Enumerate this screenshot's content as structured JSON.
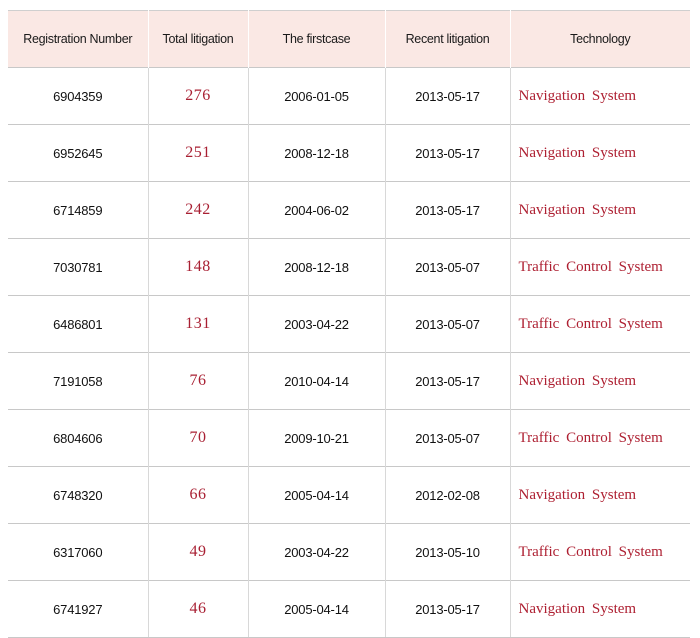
{
  "table": {
    "columns": [
      {
        "key": "registration_number",
        "label": "Registration Number"
      },
      {
        "key": "total_litigation",
        "label": "Total litigation"
      },
      {
        "key": "first_case",
        "label": "The firstcase"
      },
      {
        "key": "recent_litigation",
        "label": "Recent litigation"
      },
      {
        "key": "technology",
        "label": "Technology"
      }
    ],
    "rows": [
      {
        "registration_number": "6904359",
        "total_litigation": "276",
        "first_case": "2006-01-05",
        "recent_litigation": "2013-05-17",
        "technology": "Navigation System"
      },
      {
        "registration_number": "6952645",
        "total_litigation": "251",
        "first_case": "2008-12-18",
        "recent_litigation": "2013-05-17",
        "technology": "Navigation System"
      },
      {
        "registration_number": "6714859",
        "total_litigation": "242",
        "first_case": "2004-06-02",
        "recent_litigation": "2013-05-17",
        "technology": "Navigation System"
      },
      {
        "registration_number": "7030781",
        "total_litigation": "148",
        "first_case": "2008-12-18",
        "recent_litigation": "2013-05-07",
        "technology": "Traffic Control System"
      },
      {
        "registration_number": "6486801",
        "total_litigation": "131",
        "first_case": "2003-04-22",
        "recent_litigation": "2013-05-07",
        "technology": "Traffic Control System"
      },
      {
        "registration_number": "7191058",
        "total_litigation": "76",
        "first_case": "2010-04-14",
        "recent_litigation": "2013-05-17",
        "technology": "Navigation System"
      },
      {
        "registration_number": "6804606",
        "total_litigation": "70",
        "first_case": "2009-10-21",
        "recent_litigation": "2013-05-07",
        "technology": "Traffic Control System"
      },
      {
        "registration_number": "6748320",
        "total_litigation": "66",
        "first_case": "2005-04-14",
        "recent_litigation": "2012-02-08",
        "technology": "Navigation System"
      },
      {
        "registration_number": "6317060",
        "total_litigation": "49",
        "first_case": "2003-04-22",
        "recent_litigation": "2013-05-10",
        "technology": "Traffic Control System"
      },
      {
        "registration_number": "6741927",
        "total_litigation": "46",
        "first_case": "2005-04-14",
        "recent_litigation": "2013-05-17",
        "technology": "Navigation System"
      }
    ]
  },
  "colors": {
    "header_background": "#fae8e4",
    "accent_red": "#ae2032",
    "total_red": "#a81f32",
    "text_black": "#111111",
    "grid_line": "#c8c8c8"
  }
}
